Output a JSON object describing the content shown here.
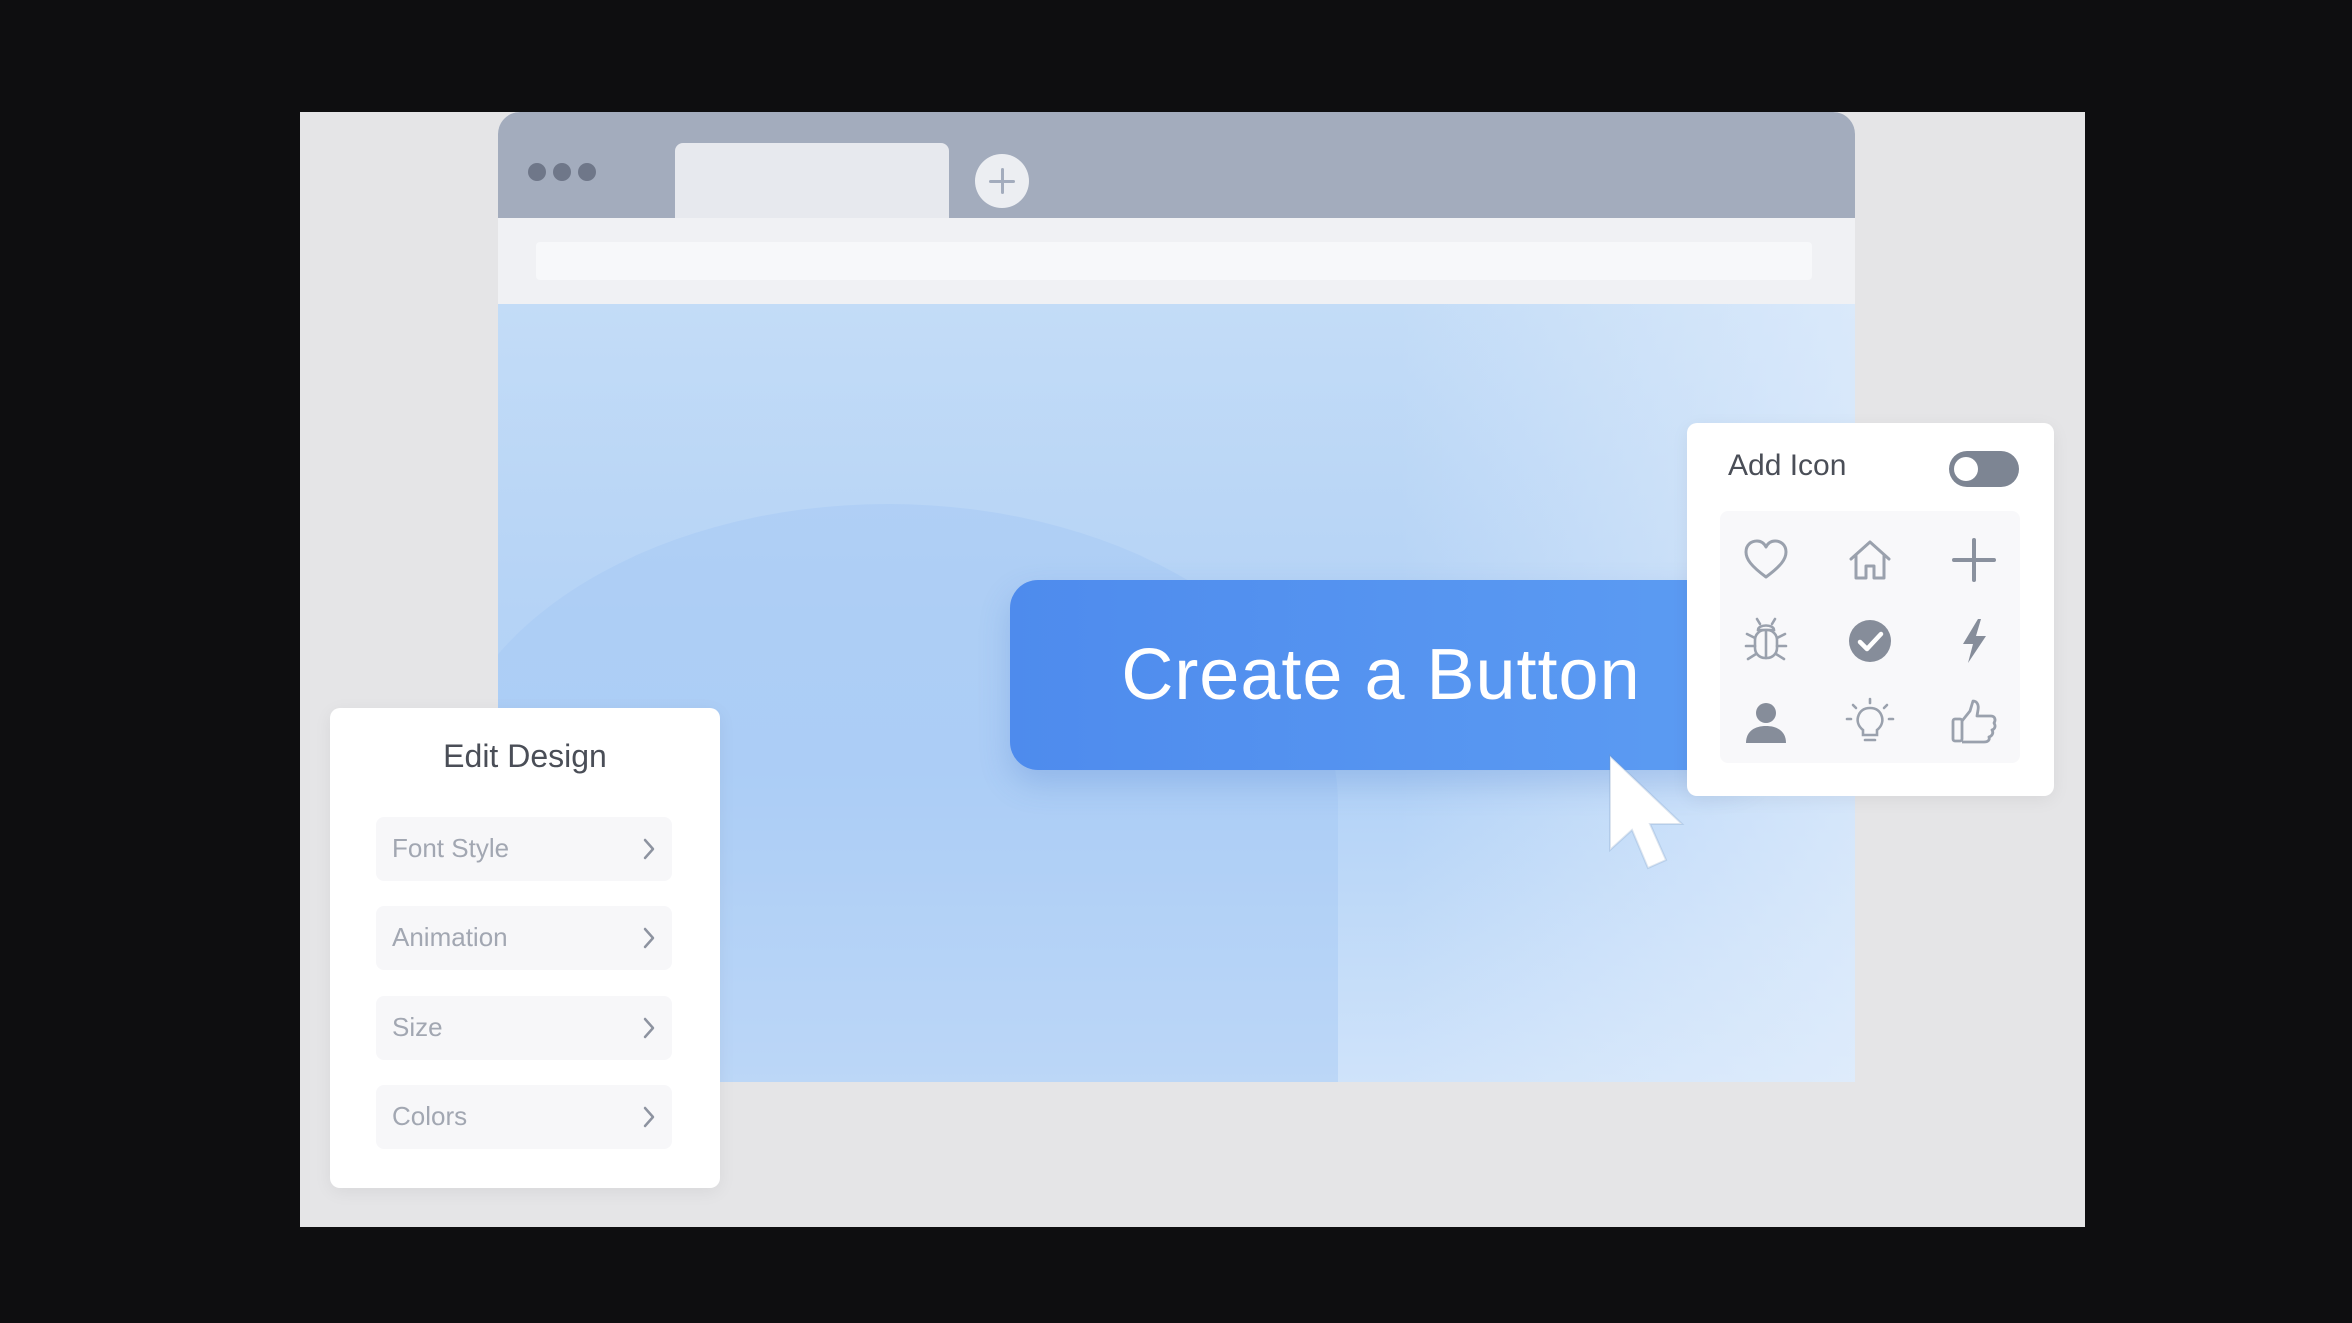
{
  "hero": {
    "button_label": "Create a Button"
  },
  "edit_panel": {
    "title": "Edit Design",
    "rows": [
      {
        "label": "Font Style"
      },
      {
        "label": "Animation"
      },
      {
        "label": "Size"
      },
      {
        "label": "Colors"
      }
    ]
  },
  "icon_panel": {
    "title": "Add Icon",
    "toggle_on": false,
    "icons": [
      "heart-icon",
      "home-icon",
      "plus-icon",
      "bug-icon",
      "check-circle-icon",
      "lightning-icon",
      "user-icon",
      "lightbulb-icon",
      "thumbs-up-icon"
    ]
  },
  "colors": {
    "button_blue": "#5592f0",
    "titlebar": "#a3acbd",
    "canvas_blue": "#b5d3f6",
    "icon_gray": "#9aa1ad"
  }
}
